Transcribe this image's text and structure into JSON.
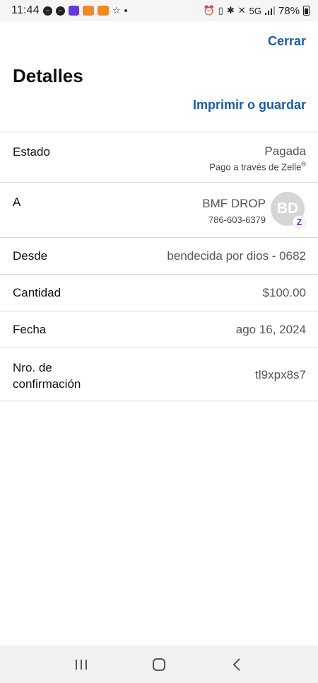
{
  "status_bar": {
    "time": "11:44",
    "network": "5G",
    "battery": "78%"
  },
  "header": {
    "close_label": "Cerrar",
    "title": "Detalles",
    "print_label": "Imprimir o guardar"
  },
  "details": {
    "status": {
      "label": "Estado",
      "value": "Pagada",
      "sub": "Pago a través de Zelle",
      "sub_mark": "®"
    },
    "to": {
      "label": "A",
      "name": "BMF DROP",
      "phone": "786-603-6379",
      "avatar_initials": "BD",
      "badge_glyph": "Z"
    },
    "from": {
      "label": "Desde",
      "value": "bendecida por dios - 0682"
    },
    "amount": {
      "label": "Cantidad",
      "value": "$100.00"
    },
    "date": {
      "label": "Fecha",
      "value": "ago 16, 2024"
    },
    "confirmation": {
      "label_line1": "Nro. de",
      "label_line2": "confirmación",
      "value": "tl9xpx8s7"
    }
  },
  "colors": {
    "link": "#1d5aa6",
    "zelle_purple": "#6d1ed4",
    "divider": "#d9d9d9"
  },
  "icons": {
    "nav": [
      "recent-apps-icon",
      "home-icon",
      "back-icon"
    ]
  }
}
